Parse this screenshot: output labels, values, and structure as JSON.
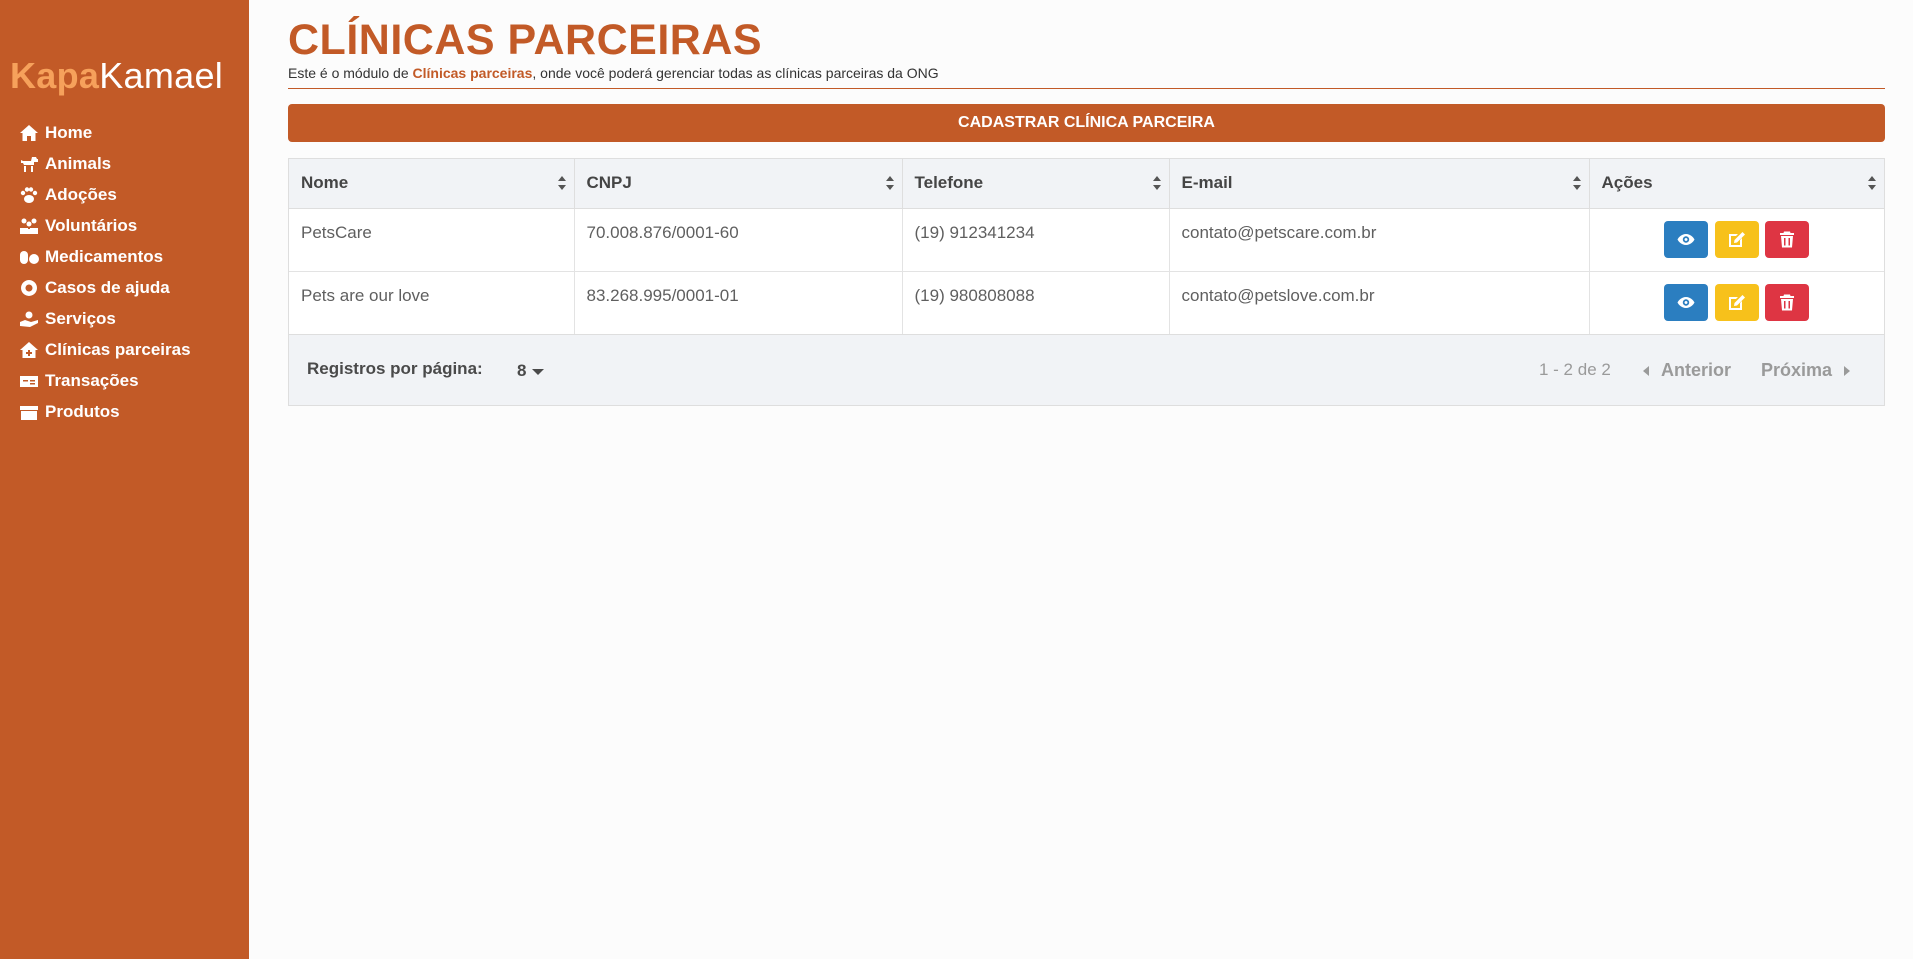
{
  "brand": {
    "part1": "Kapa",
    "part2": "Kamael"
  },
  "sidebar": {
    "items": [
      {
        "label": "Home",
        "icon": "home-icon"
      },
      {
        "label": "Animals",
        "icon": "dog-icon"
      },
      {
        "label": "Adoções",
        "icon": "paw-icon"
      },
      {
        "label": "Voluntários",
        "icon": "people-icon"
      },
      {
        "label": "Medicamentos",
        "icon": "pills-icon"
      },
      {
        "label": "Casos de ajuda",
        "icon": "life-ring-icon"
      },
      {
        "label": "Serviços",
        "icon": "hand-holding-icon"
      },
      {
        "label": "Clínicas parceiras",
        "icon": "clinic-icon"
      },
      {
        "label": "Transações",
        "icon": "money-bill-icon"
      },
      {
        "label": "Produtos",
        "icon": "box-icon"
      }
    ]
  },
  "header": {
    "title": "CLÍNICAS PARCEIRAS",
    "subtitle_pre": "Este é o módulo de ",
    "subtitle_bold": "Clínicas parceiras",
    "subtitle_post": ", onde você poderá gerenciar todas as clínicas parceiras da ONG"
  },
  "actions": {
    "register_label": "CADASTRAR CLÍNICA PARCEIRA"
  },
  "table": {
    "columns": [
      "Nome",
      "CNPJ",
      "Telefone",
      "E-mail",
      "Ações"
    ],
    "rows": [
      [
        "PetsCare",
        "70.008.876/0001-60",
        "(19) 912341234",
        "contato@petscare.com.br"
      ],
      [
        "Pets are our love",
        "83.268.995/0001-01",
        "(19) 980808088",
        "contato@petslove.com.br"
      ]
    ],
    "row_actions": [
      "eye-icon",
      "edit-icon",
      "trash-icon"
    ]
  },
  "pagination": {
    "rows_per_page_label": "Registros por página:",
    "rows_per_page_value": "8",
    "range": "1 - 2 de 2",
    "prev_label": "Anterior",
    "next_label": "Próxima"
  },
  "colors": {
    "brand": "#c25a27",
    "brand_light": "#f6a15b",
    "view": "#2b7ec0",
    "edit": "#f7c11b",
    "delete": "#de3543"
  }
}
